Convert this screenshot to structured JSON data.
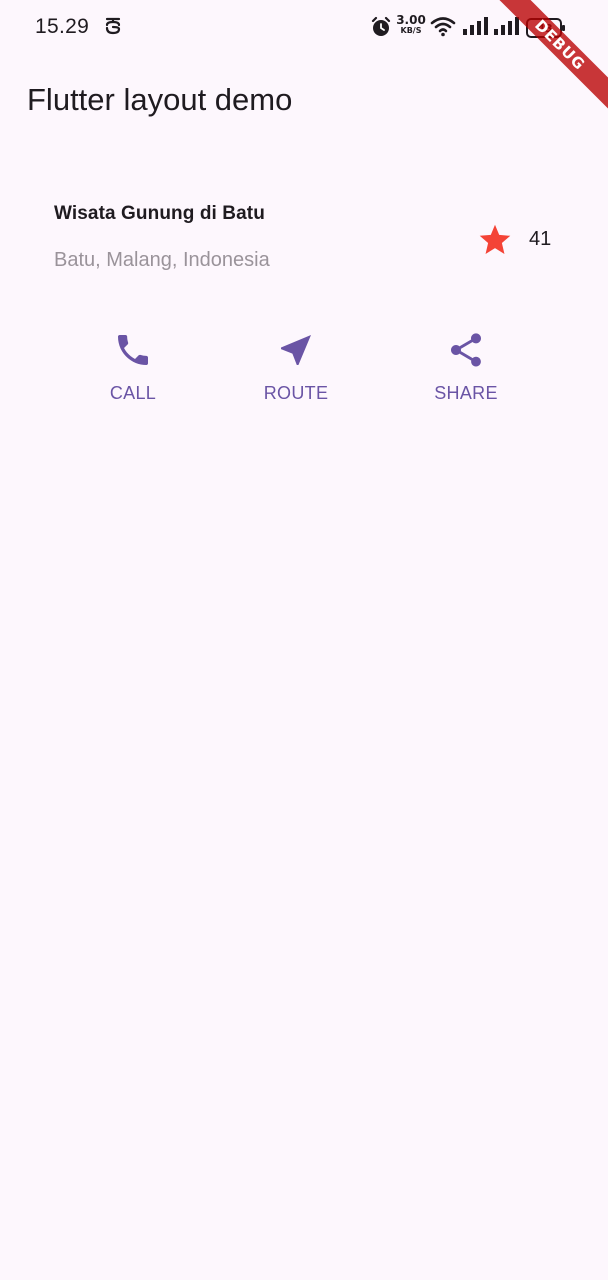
{
  "status_bar": {
    "time": "15.29",
    "net_speed_value": "3.00",
    "net_speed_unit": "KB/S",
    "battery_level": "43",
    "icons": [
      "s-app-icon",
      "alarm-icon",
      "wifi-icon",
      "signal-icon",
      "signal-icon",
      "battery-icon"
    ]
  },
  "debug_banner": {
    "label": "DEBUG"
  },
  "app_bar": {
    "title": "Flutter layout demo"
  },
  "title_section": {
    "name": "Wisata Gunung di Batu",
    "location": "Batu, Malang, Indonesia",
    "star_icon": "star-icon",
    "star_color": "#f44336",
    "rating_count": "41"
  },
  "buttons": [
    {
      "label": "CALL",
      "icon": "phone-icon"
    },
    {
      "label": "ROUTE",
      "icon": "near-me-icon"
    },
    {
      "label": "SHARE",
      "icon": "share-icon"
    }
  ],
  "colors": {
    "background": "#fdf7fd",
    "accent": "#6a54a5",
    "text_primary": "#1f1b20",
    "text_secondary": "#9a939a"
  }
}
